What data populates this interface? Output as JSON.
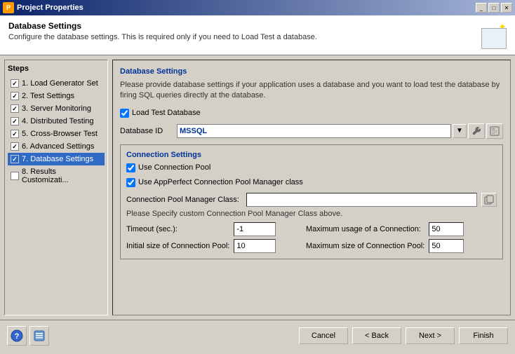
{
  "titlebar": {
    "title": "Project Properties",
    "icon": "P",
    "controls": [
      "_",
      "□",
      "✕"
    ]
  },
  "header": {
    "title": "Database Settings",
    "description": "Configure the database settings. This is required only if you need to Load Test a database."
  },
  "steps": {
    "label": "Steps",
    "items": [
      {
        "id": 1,
        "label": "1. Load Generator Set",
        "checked": true,
        "active": false
      },
      {
        "id": 2,
        "label": "2. Test Settings",
        "checked": true,
        "active": false
      },
      {
        "id": 3,
        "label": "3. Server Monitoring",
        "checked": true,
        "active": false
      },
      {
        "id": 4,
        "label": "4. Distributed Testing",
        "checked": true,
        "active": false
      },
      {
        "id": 5,
        "label": "5. Cross-Browser Test",
        "checked": true,
        "active": false
      },
      {
        "id": 6,
        "label": "6. Advanced Settings",
        "checked": true,
        "active": false
      },
      {
        "id": 7,
        "label": "7. Database Settings",
        "checked": true,
        "active": true
      },
      {
        "id": 8,
        "label": "8. Results Customizati...",
        "checked": false,
        "active": false
      }
    ]
  },
  "database_settings": {
    "section_title": "Database Settings",
    "description": "Please provide database settings if your application uses a database and you want to load test the database by firing SQL queries directly at the database.",
    "load_test_checkbox_label": "Load Test Database",
    "load_test_checked": true,
    "database_id_label": "Database ID",
    "database_id_value": "MSSQL",
    "connection_settings": {
      "title": "Connection Settings",
      "use_connection_pool_label": "Use Connection Pool",
      "use_connection_pool_checked": true,
      "use_appperfect_label": "Use AppPerfect Connection Pool Manager class",
      "use_appperfect_checked": true,
      "pool_manager_class_label": "Connection Pool Manager Class:",
      "pool_manager_class_value": "",
      "hint_text": "Please Specify custom Connection Pool Manager Class above.",
      "timeout_label": "Timeout (sec.):",
      "timeout_value": "-1",
      "max_usage_label": "Maximum usage of a Connection:",
      "max_usage_value": "50",
      "initial_size_label": "Initial size of Connection Pool:",
      "initial_size_value": "10",
      "max_size_label": "Maximum size of Connection Pool:",
      "max_size_value": "50"
    }
  },
  "buttons": {
    "cancel": "Cancel",
    "back": "< Back",
    "next": "Next >",
    "finish": "Finish"
  }
}
